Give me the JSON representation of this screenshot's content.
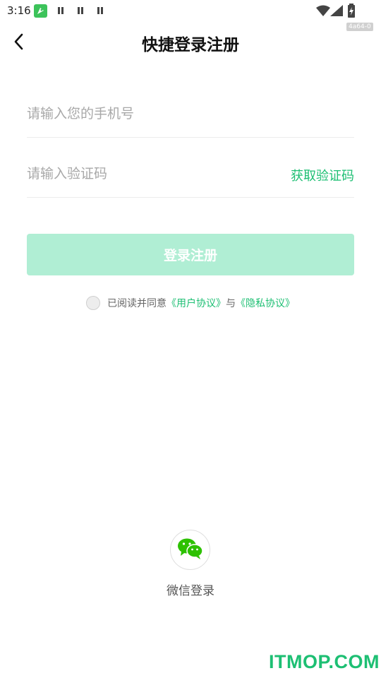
{
  "status_bar": {
    "time": "3:16",
    "icons": [
      "app-notification-icon",
      "pause-icon",
      "pause-icon",
      "pause-icon",
      "wifi-icon",
      "signal-icon",
      "battery-icon"
    ]
  },
  "header": {
    "back_icon": "back-arrow-icon",
    "title": "快捷登录注册",
    "build_tag": "4a64-0"
  },
  "form": {
    "phone": {
      "placeholder": "请输入您的手机号",
      "value": ""
    },
    "code": {
      "placeholder": "请输入验证码",
      "value": ""
    },
    "get_code_label": "获取验证码",
    "submit_label": "登录注册"
  },
  "agreement": {
    "checked": false,
    "prefix": "已阅读并同意",
    "user_agreement": "《用户协议》",
    "connector": "与",
    "privacy_policy": "《隐私协议》"
  },
  "wechat": {
    "icon": "wechat-icon",
    "label": "微信登录"
  },
  "watermark": "ITMOP.COM",
  "colors": {
    "accent": "#1dbf73",
    "button_disabled": "#b0eed4",
    "wechat_green": "#2dc100"
  }
}
